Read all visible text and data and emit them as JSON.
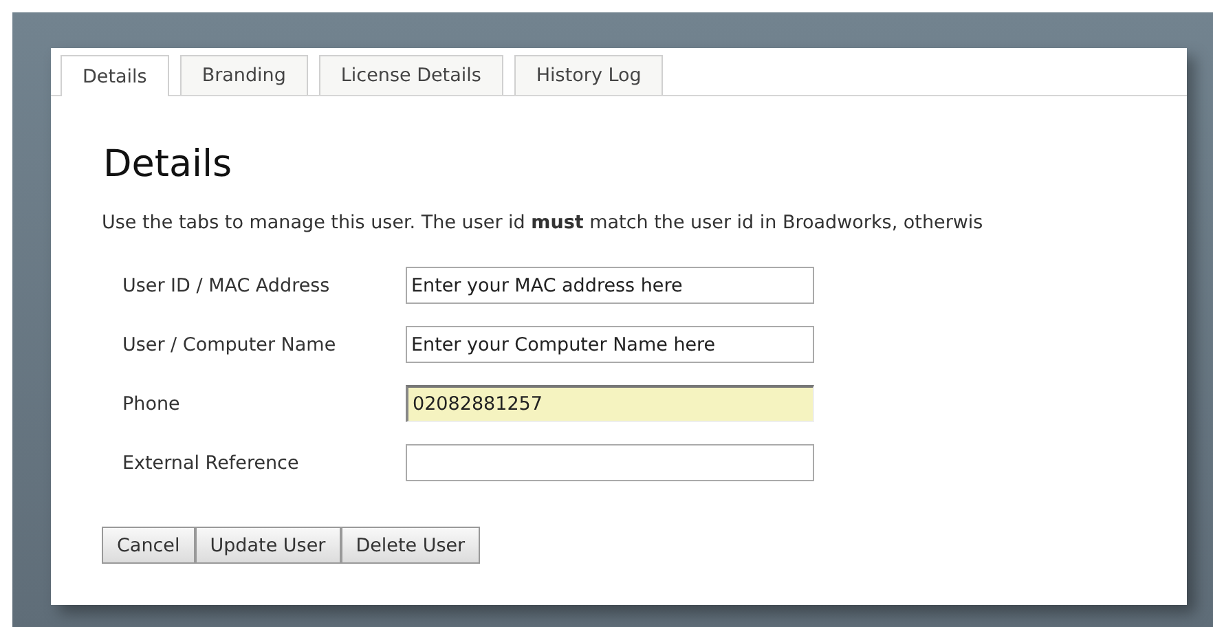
{
  "tabs": [
    {
      "label": "Details",
      "selected": true
    },
    {
      "label": "Branding",
      "selected": false
    },
    {
      "label": "License Details",
      "selected": false
    },
    {
      "label": "History Log",
      "selected": false
    }
  ],
  "heading": "Details",
  "intro": "Use the tabs to manage this user. The user id **must** match the user id in Broadworks, otherwis",
  "fields": [
    {
      "label": "User ID / MAC Address",
      "value": "Enter your MAC address here",
      "highlighted": false
    },
    {
      "label": "User / Computer Name",
      "value": "Enter your Computer Name here",
      "highlighted": false
    },
    {
      "label": "Phone",
      "value": "02082881257",
      "highlighted": true
    },
    {
      "label": "External Reference",
      "highlighted": false
    }
  ],
  "buttons": [
    "Cancel",
    "Update User",
    "Delete User"
  ]
}
